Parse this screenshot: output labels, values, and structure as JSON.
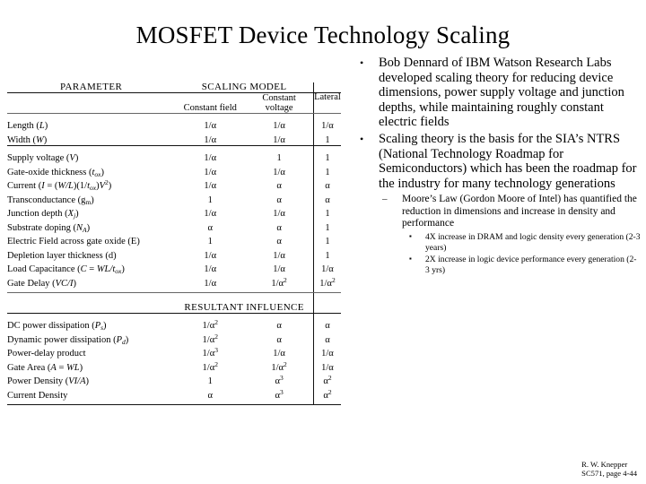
{
  "slide": {
    "title": "MOSFET Device Technology Scaling"
  },
  "table": {
    "header": {
      "parameter": "PARAMETER",
      "scaling_model": "SCALING MODEL",
      "col_constant_field": "Constant field",
      "col_constant_voltage_line1": "Constant",
      "col_constant_voltage_line2": "voltage",
      "col_lateral": "Lateral"
    },
    "section_resultant": "RESULTANT INFLUENCE",
    "group1": [
      {
        "param_html": "Length (<i>L</i>)",
        "cf": "1/α",
        "cv": "1/α",
        "lat": "1/α"
      },
      {
        "param_html": "Width (<i>W</i>)",
        "cf": "1/α",
        "cv": "1/α",
        "lat": "1"
      }
    ],
    "group2": [
      {
        "param_html": "Supply voltage (<i>V</i>)",
        "cf": "1/α",
        "cv": "1",
        "lat": "1"
      },
      {
        "param_html": "Gate-oxide thickness (<i>t<sub>ox</sub></i>)",
        "cf": "1/α",
        "cv": "1/α",
        "lat": "1"
      },
      {
        "param_html": "Current (<i>I</i> = (<i>W/L</i>)(1/<i>t<sub>ox</sub></i>)<i>V</i><sup>2</sup>)",
        "cf": "1/α",
        "cv": "α",
        "lat": "α"
      },
      {
        "param_html": "Transconductance (g<sub>m</sub>)",
        "cf": "1",
        "cv": "α",
        "lat": "α"
      },
      {
        "param_html": "Junction depth (<i>X<sub>j</sub></i>)",
        "cf": "1/α",
        "cv": "1/α",
        "lat": "1"
      },
      {
        "param_html": "Substrate doping (<i>N<sub>A</sub></i>)",
        "cf": "α",
        "cv": "α",
        "lat": "1"
      },
      {
        "param_html": "Electric Field across gate oxide (E)",
        "cf": "1",
        "cv": "α",
        "lat": "1"
      },
      {
        "param_html": "Depletion layer thickness (d)",
        "cf": "1/α",
        "cv": "1/α",
        "lat": "1"
      },
      {
        "param_html": "Load Capacitance (<i>C</i> = <i>WL/t<sub>ox</sub></i>)",
        "cf": "1/α",
        "cv": "1/α",
        "lat": "1/α"
      },
      {
        "param_html": "Gate Delay (<i>VC/I</i>)",
        "cf": "1/α",
        "cv": "1/α<sup>2</sup>",
        "lat": "1/α<sup>2</sup>"
      }
    ],
    "group3": [
      {
        "param_html": "DC power dissipation (<i>P<sub>s</sub></i>)",
        "cf": "1/α<sup>2</sup>",
        "cv": "α",
        "lat": "α"
      },
      {
        "param_html": "Dynamic power dissipation (<i>P<sub>d</sub></i>)",
        "cf": "1/α<sup>2</sup>",
        "cv": "α",
        "lat": "α"
      },
      {
        "param_html": "Power-delay product",
        "cf": "1/α<sup>3</sup>",
        "cv": "1/α",
        "lat": "1/α"
      },
      {
        "param_html": "Gate Area (<i>A</i> = <i>WL</i>)",
        "cf": "1/α<sup>2</sup>",
        "cv": "1/α<sup>2</sup>",
        "lat": "1/α"
      },
      {
        "param_html": "Power Density (<i>VI/A</i>)",
        "cf": "1",
        "cv": "α<sup>3</sup>",
        "lat": "α<sup>2</sup>"
      },
      {
        "param_html": "Current Density",
        "cf": "α",
        "cv": "α<sup>3</sup>",
        "lat": "α<sup>2</sup>"
      }
    ]
  },
  "bullets": {
    "marker_level1": "•",
    "marker_level2": "–",
    "marker_level3": "▪",
    "level1": [
      "Bob Dennard of IBM Watson Research Labs developed scaling theory for reducing device dimensions, power supply voltage and junction depths, while maintaining roughly constant electric fields",
      "Scaling theory is the basis for the SIA’s NTRS (National Technology Roadmap for Semiconductors) which has been the roadmap for the industry for many technology generations"
    ],
    "level2": [
      "Moore’s Law (Gordon Moore of Intel) has quantified the reduction in dimensions and increase in density and performance"
    ],
    "level3": [
      "4X increase in DRAM and logic density every generation (2-3 years)",
      "2X increase in logic device performance every generation (2-3 yrs)"
    ]
  },
  "footer": {
    "line1": "R. W. Knepper",
    "line2": "SC571, page 4-44"
  }
}
